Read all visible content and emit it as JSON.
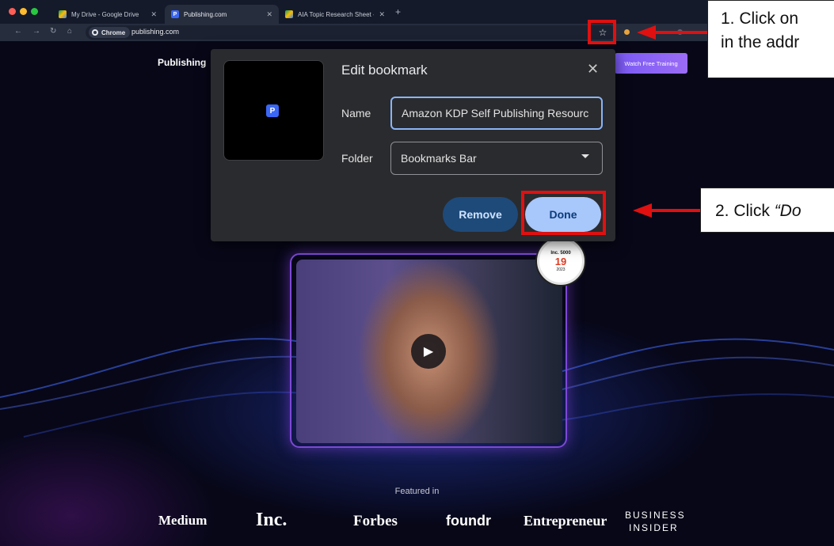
{
  "browser": {
    "tabs": [
      {
        "title": "My Drive - Google Drive",
        "icon": "google-drive-icon",
        "active": false
      },
      {
        "title": "Publishing.com",
        "icon": "publishing-favicon",
        "active": true
      },
      {
        "title": "AIA Topic Research Sheet - M",
        "icon": "google-sheets-icon",
        "active": false
      }
    ],
    "chip_label": "Chrome",
    "url": "publishing.com"
  },
  "page": {
    "brand": "Publishing",
    "cta_label": "Watch Free Training",
    "badge": {
      "line1": "Inc. 5000",
      "line2": "19",
      "line3": "2023"
    },
    "featured_label": "Featured in",
    "logos": [
      "Medium",
      "Inc.",
      "Forbes",
      "foundr",
      "Entrepreneur",
      "BUSINESS",
      "INSIDER"
    ]
  },
  "dialog": {
    "title": "Edit bookmark",
    "name_label": "Name",
    "name_value": "Amazon KDP Self Publishing Resourc",
    "folder_label": "Folder",
    "folder_value": "Bookmarks Bar",
    "remove_label": "Remove",
    "done_label": "Done"
  },
  "annotations": {
    "step1_line1": "1. Click on",
    "step1_line2": "in the addr",
    "step2_prefix": "2. Click ",
    "step2_emph": "“Do"
  },
  "colors": {
    "annotation_red": "#e01010",
    "cta_purple": "#7a5af5",
    "done_blue": "#a8c7fa",
    "remove_blue": "#1e4a7a",
    "dialog_bg": "#2a2b2e"
  }
}
